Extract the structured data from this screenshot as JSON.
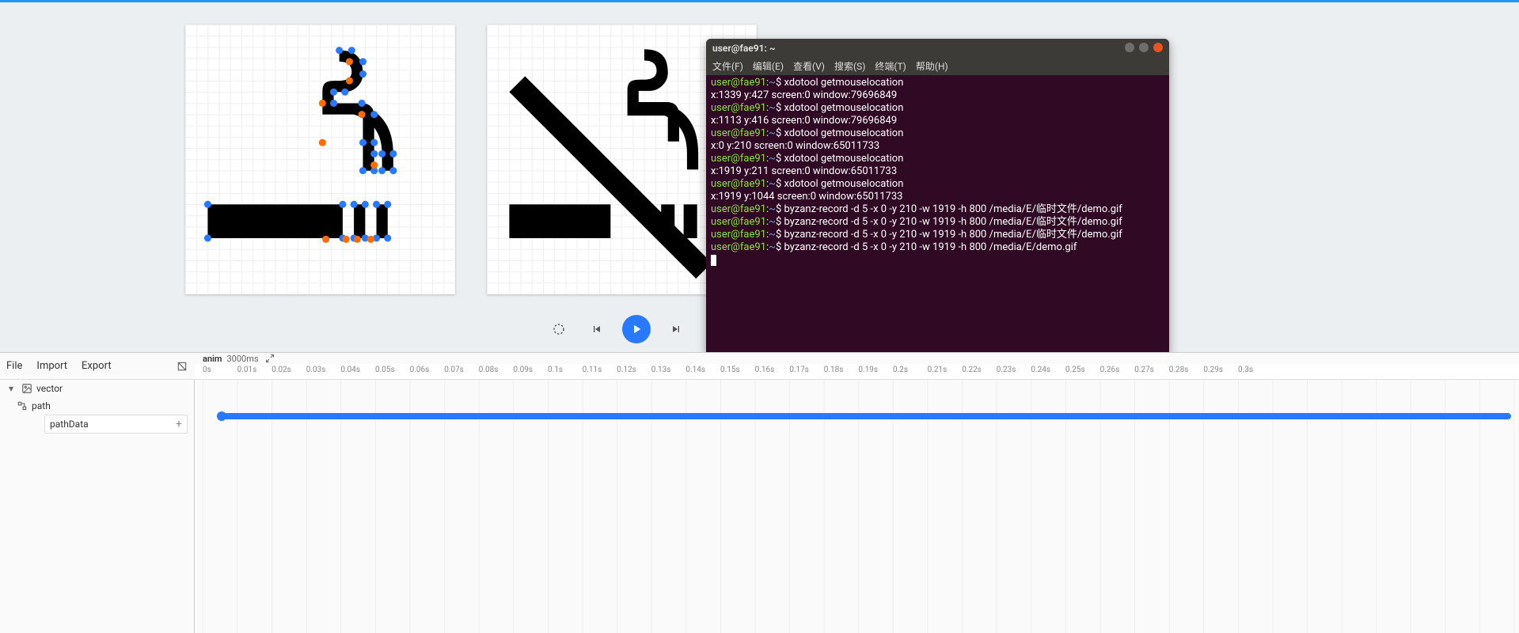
{
  "app": {
    "topbar_color": "#2196f3"
  },
  "transport": {
    "reset_tt": "Reset",
    "prev_tt": "Previous",
    "play_tt": "Play",
    "next_tt": "Next",
    "loop_tt": "Loop"
  },
  "terminal": {
    "title": "user@fae91: ~",
    "menu": [
      "文件(F)",
      "编辑(E)",
      "查看(V)",
      "搜索(S)",
      "终端(T)",
      "帮助(H)"
    ],
    "dots": [
      "#6e6e6e",
      "#6e6e6e",
      "#e95420"
    ],
    "prompt_user": "user@fae91",
    "prompt_sep": ":",
    "prompt_path": "~",
    "prompt_end": "$ ",
    "lines": [
      {
        "t": "cmd",
        "cmd": "xdotool getmouselocation"
      },
      {
        "t": "out",
        "text": "x:1339 y:427 screen:0 window:79696849"
      },
      {
        "t": "cmd",
        "cmd": "xdotool getmouselocation"
      },
      {
        "t": "out",
        "text": "x:1113 y:416 screen:0 window:79696849"
      },
      {
        "t": "cmd",
        "cmd": "xdotool getmouselocation"
      },
      {
        "t": "out",
        "text": "x:0 y:210 screen:0 window:65011733"
      },
      {
        "t": "cmd",
        "cmd": "xdotool getmouselocation"
      },
      {
        "t": "out",
        "text": "x:1919 y:211 screen:0 window:65011733"
      },
      {
        "t": "cmd",
        "cmd": "xdotool getmouselocation"
      },
      {
        "t": "out",
        "text": "x:1919 y:1044 screen:0 window:65011733"
      },
      {
        "t": "cmd",
        "cmd": "byzanz-record -d 5 -x 0 -y 210 -w 1919 -h 800 /media/E/临时文件/demo.gif"
      },
      {
        "t": "cmd",
        "cmd": "byzanz-record -d 5 -x 0 -y 210 -w 1919 -h 800 /media/E/临时文件/demo.gif"
      },
      {
        "t": "cmd",
        "cmd": "byzanz-record -d 5 -x 0 -y 210 -w 1919 -h 800 /media/E/临时文件/demo.gif"
      },
      {
        "t": "cmd",
        "cmd": "byzanz-record -d 5 -x 0 -y 210 -w 1919 -h 800 /media/E/demo.gif",
        "cursor": true
      }
    ]
  },
  "toolbar": {
    "file": "File",
    "import": "Import",
    "export": "Export"
  },
  "layers": {
    "root": "vector",
    "child": "path",
    "prop": "pathData"
  },
  "timeline": {
    "name": "anim",
    "duration": "3000ms",
    "ticks": [
      "0s",
      "0.01s",
      "0.02s",
      "0.03s",
      "0.04s",
      "0.05s",
      "0.06s",
      "0.07s",
      "0.08s",
      "0.09s",
      "0.1s",
      "0.11s",
      "0.12s",
      "0.13s",
      "0.14s",
      "0.15s",
      "0.16s",
      "0.17s",
      "0.18s",
      "0.19s",
      "0.2s",
      "0.21s",
      "0.22s",
      "0.23s",
      "0.24s",
      "0.25s",
      "0.26s",
      "0.27s",
      "0.28s",
      "0.29s",
      "0.3s"
    ]
  },
  "canvases": {
    "left_points_blue": [
      [
        13.7,
        2.3
      ],
      [
        14.8,
        2.3
      ],
      [
        15.8,
        3.3
      ],
      [
        15.8,
        4.4
      ],
      [
        14.2,
        6.0
      ],
      [
        13.2,
        6.0
      ],
      [
        13.2,
        7.0
      ],
      [
        15.7,
        7.0
      ],
      [
        16.8,
        8.0
      ],
      [
        16.8,
        10.5
      ],
      [
        15.8,
        10.5
      ],
      [
        15.8,
        13.0
      ],
      [
        16.8,
        13.0
      ],
      [
        16.8,
        11.5
      ],
      [
        17.5,
        11.5
      ],
      [
        17.5,
        13.0
      ],
      [
        18.5,
        13.0
      ],
      [
        18.5,
        11.5
      ],
      [
        2.0,
        16.0
      ],
      [
        2.0,
        19.0
      ],
      [
        14.0,
        19.0
      ],
      [
        14.0,
        16.0
      ],
      [
        15.0,
        16.0
      ],
      [
        15.0,
        19.0
      ],
      [
        16.0,
        19.0
      ],
      [
        16.0,
        16.0
      ],
      [
        17.0,
        16.0
      ],
      [
        17.0,
        19.0
      ],
      [
        18.0,
        19.0
      ],
      [
        18.0,
        16.0
      ]
    ],
    "left_points_orange": [
      [
        14.6,
        3.3
      ],
      [
        14.6,
        5.0
      ],
      [
        12.2,
        7.0
      ],
      [
        15.7,
        8.0
      ],
      [
        12.2,
        10.5
      ],
      [
        16.8,
        12.5
      ],
      [
        12.5,
        19.1
      ],
      [
        14.3,
        19.1
      ],
      [
        15.3,
        19.1
      ],
      [
        16.5,
        19.1
      ]
    ]
  }
}
